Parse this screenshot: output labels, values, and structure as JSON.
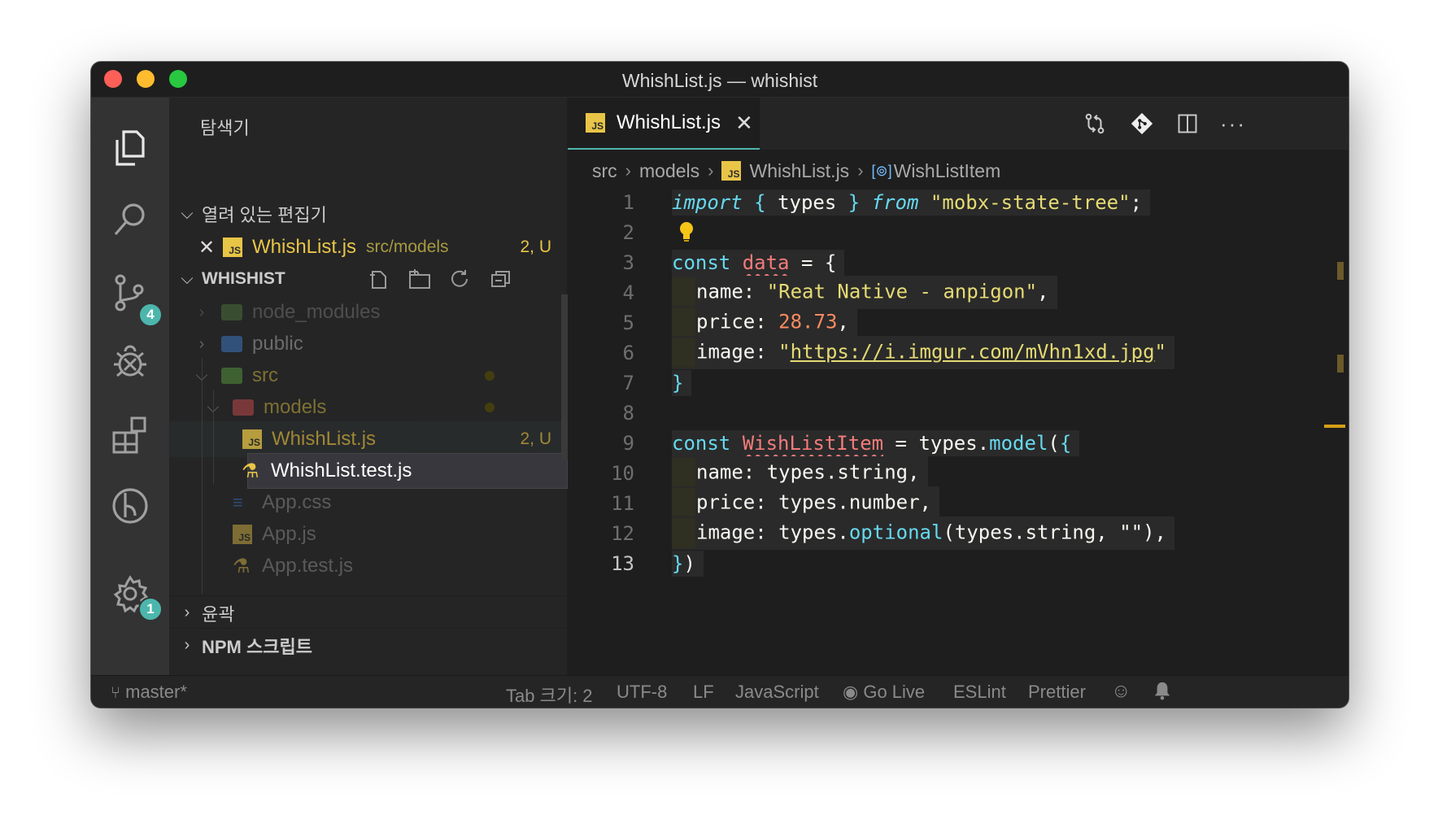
{
  "window": {
    "title": "WhishList.js — whishist"
  },
  "activity_bar": {
    "scm_badge": "4",
    "settings_badge": "1"
  },
  "sidebar": {
    "title": "탐색기",
    "open_editors": {
      "label": "열려 있는 편집기",
      "item": {
        "name": "WhishList.js",
        "path": "src/models",
        "status": "2, U"
      }
    },
    "project": {
      "label": "WHISHIST",
      "tree": [
        {
          "name": "node_modules"
        },
        {
          "name": "public"
        },
        {
          "name": "src"
        },
        {
          "name": "models"
        },
        {
          "name": "WhishList.js",
          "status": "2, U"
        },
        {
          "name": "WhishList.test.js"
        },
        {
          "name": "App.css"
        },
        {
          "name": "App.js"
        },
        {
          "name": "App.test.js"
        }
      ]
    },
    "outline_label": "윤곽",
    "npm_label": "NPM 스크립트"
  },
  "editor": {
    "tab": {
      "label": "WhishList.js"
    },
    "breadcrumb": [
      "src",
      "models",
      "WhishList.js",
      "WishListItem"
    ],
    "lines": [
      "1",
      "2",
      "3",
      "4",
      "5",
      "6",
      "7",
      "8",
      "9",
      "10",
      "11",
      "12",
      "13"
    ],
    "code": {
      "l1_import": "import",
      "l1_open": " { ",
      "l1_types": "types",
      "l1_close": " } ",
      "l1_from": "from",
      "l1_mod": " \"mobx-state-tree\"",
      "l1_semi": ";",
      "l3_const": "const",
      "l3_var": "data",
      "l3_rest": " = {",
      "l4_key": "name: ",
      "l4_val": "\"Reat Native - anpigon\"",
      "l4_end": ",",
      "l5_key": "price: ",
      "l5_val": "28.73",
      "l5_end": ",",
      "l6_key": "image: ",
      "l6_q1": "\"",
      "l6_url": "https://i.imgur.com/mVhn1xd.jpg",
      "l6_q2": "\"",
      "l7": "}",
      "l9_const": "const",
      "l9_var": "WishListItem",
      "l9_eq": " = ",
      "l9_types": "types",
      "l9_dot": ".",
      "l9_fn": "model",
      "l9_paren": "(",
      "l9_brace": "{",
      "l10_key": "name: ",
      "l10_val": "types.string",
      "l10_end": ",",
      "l11_key": "price: ",
      "l11_val": "types.number",
      "l11_end": ",",
      "l12_key": "image: ",
      "l12_types": "types.",
      "l12_fn": "optional",
      "l12_args": "(types.string, \"\"),",
      "l13_brace": "}",
      "l13_paren": ")"
    }
  },
  "statusbar": {
    "branch": "master*",
    "tab_size": "Tab 크기: 2",
    "encoding": "UTF-8",
    "eol": "LF",
    "language": "JavaScript",
    "go_live": "Go Live",
    "eslint": "ESLint",
    "prettier": "Prettier"
  }
}
